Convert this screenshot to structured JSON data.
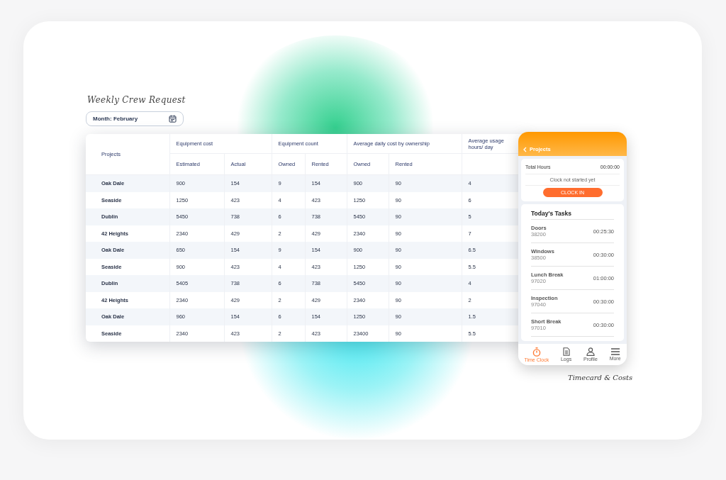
{
  "title": "Weekly Crew Request",
  "month_field": {
    "value": "Month: February"
  },
  "table": {
    "column_groups": [
      {
        "label": "Projects"
      },
      {
        "label": "Equipment cost",
        "columns": [
          "Estimated",
          "Actual"
        ]
      },
      {
        "label": "Equipment count",
        "columns": [
          "Owned",
          "Rented"
        ]
      },
      {
        "label": "Average daily cost by ownership",
        "columns": [
          "Owned",
          "Rented"
        ]
      },
      {
        "label": "Average usage hours/ day"
      }
    ],
    "rows": [
      [
        "Oak Dale",
        "900",
        "154",
        "9",
        "154",
        "900",
        "90",
        "4"
      ],
      [
        "Seaside",
        "1250",
        "423",
        "4",
        "423",
        "1250",
        "90",
        "6"
      ],
      [
        "Dublin",
        "5450",
        "738",
        "6",
        "738",
        "5450",
        "90",
        "5"
      ],
      [
        "42 Heights",
        "2340",
        "429",
        "2",
        "429",
        "2340",
        "90",
        "7"
      ],
      [
        "Oak Dale",
        "650",
        "154",
        "9",
        "154",
        "900",
        "90",
        "6.5"
      ],
      [
        "Seaside",
        "900",
        "423",
        "4",
        "423",
        "1250",
        "90",
        "5.5"
      ],
      [
        "Dublin",
        "5405",
        "738",
        "6",
        "738",
        "5450",
        "90",
        "4"
      ],
      [
        "42 Heights",
        "2340",
        "429",
        "2",
        "429",
        "2340",
        "90",
        "2"
      ],
      [
        "Oak Dale",
        "960",
        "154",
        "6",
        "154",
        "1250",
        "90",
        "1.5"
      ],
      [
        "Seaside",
        "2340",
        "423",
        "2",
        "423",
        "23400",
        "90",
        "5.5"
      ]
    ]
  },
  "phone": {
    "back_label": "Projects",
    "total_label": "Total Hours",
    "total_value": "00:00:00",
    "status": "Clock not started yet",
    "clock_button": "CLOCK IN",
    "tasks_title": "Today's Tasks",
    "tasks": [
      {
        "name": "Doors",
        "code": "38200",
        "time": "00:25:30"
      },
      {
        "name": "Windows",
        "code": "38500",
        "time": "00:30:00"
      },
      {
        "name": "Lunch Break",
        "code": "97020",
        "time": "01:00:00"
      },
      {
        "name": "Inspection",
        "code": "97040",
        "time": "00:30:00"
      },
      {
        "name": "Short Break",
        "code": "97010",
        "time": "00:30:00"
      }
    ],
    "nav": [
      {
        "label": "Time Clock",
        "selected": true
      },
      {
        "label": "Logs",
        "selected": false
      },
      {
        "label": "Profile",
        "selected": false
      },
      {
        "label": "More",
        "selected": false
      }
    ]
  },
  "caption": "Timecard & Costs"
}
